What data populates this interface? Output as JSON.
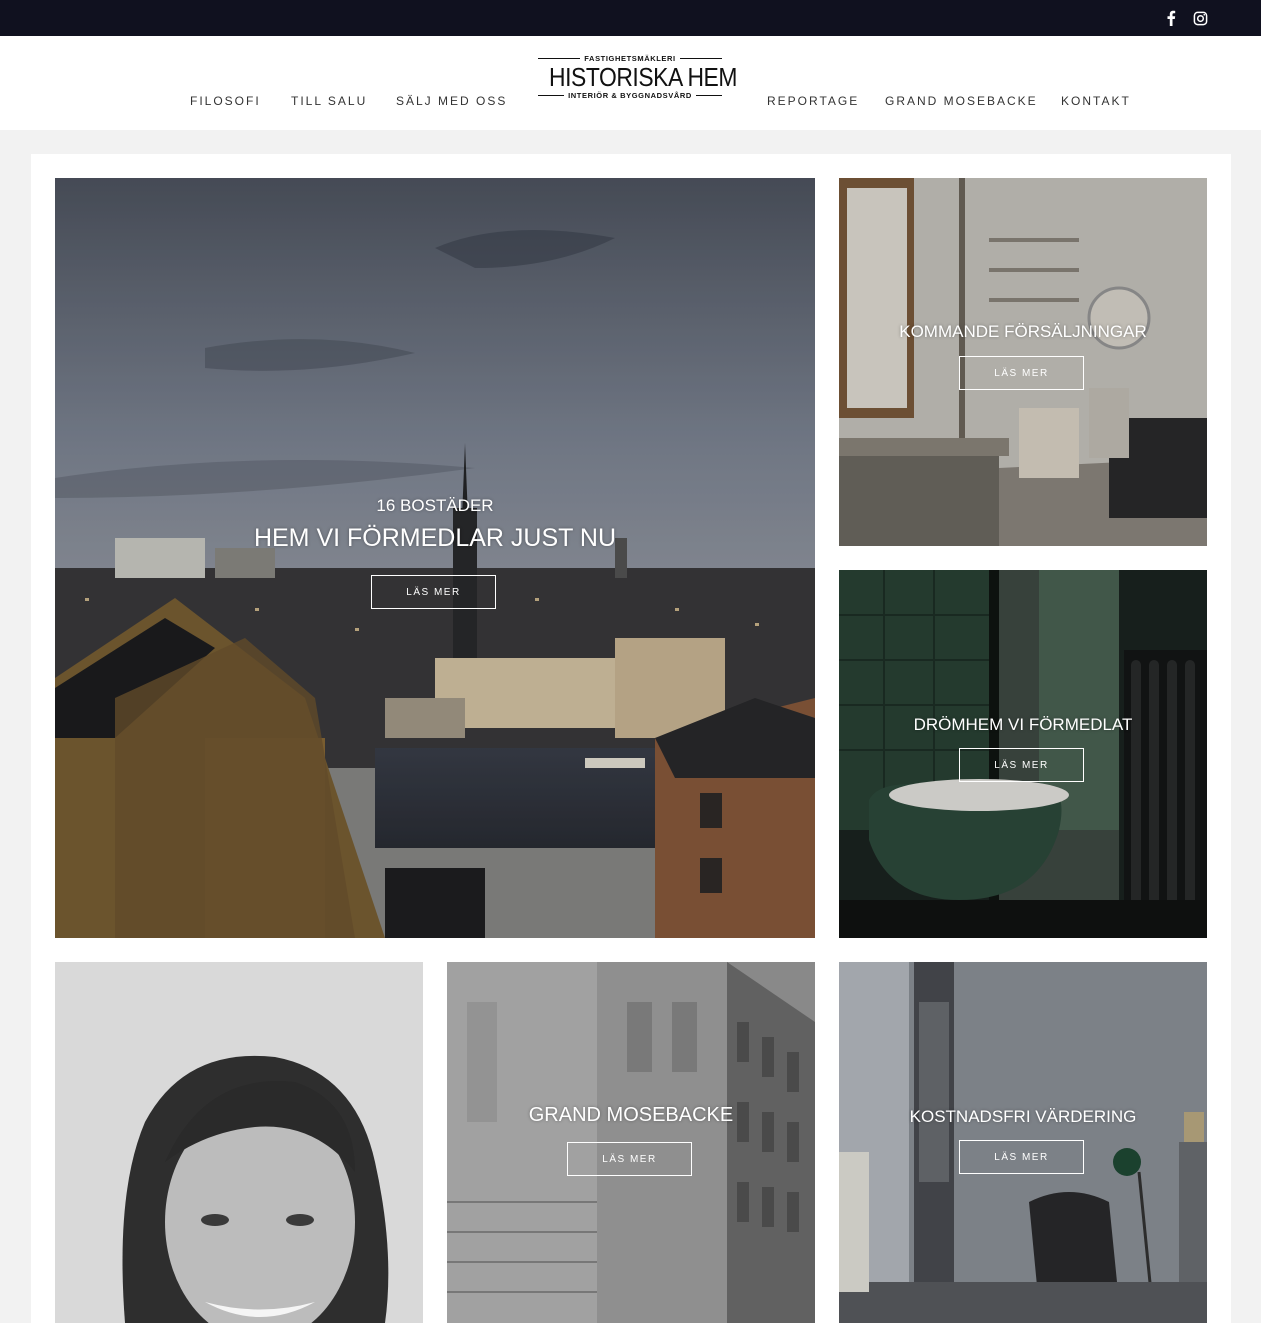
{
  "social": {
    "facebook_icon": "facebook-icon",
    "instagram_icon": "instagram-icon"
  },
  "logo": {
    "top_text": "FASTIGHETSMÄKLERI",
    "main_text": "HISTORISKA HEM",
    "bottom_text": "INTERIÖR & BYGGNADSVÅRD"
  },
  "nav": {
    "left": [
      "FILOSOFI",
      "TILL SALU",
      "SÄLJ MED OSS"
    ],
    "right": [
      "REPORTAGE",
      "GRAND MOSEBACKE",
      "KONTAKT"
    ]
  },
  "tiles": {
    "hero": {
      "subtitle": "16 BOSTÄDER",
      "title": "HEM VI FÖRMEDLAR JUST NU",
      "button": "LÄS MER"
    },
    "upcoming": {
      "title": "KOMMANDE FÖRSÄLJNINGAR",
      "button": "LÄS MER"
    },
    "dream": {
      "title": "DRÖMHEM VI FÖRMEDLAT",
      "button": "LÄS MER"
    },
    "mosebacke": {
      "title": "GRAND MOSEBACKE",
      "button": "LÄS MER"
    },
    "valuation": {
      "title": "KOSTNADSFRI VÄRDERING",
      "button": "LÄS MER"
    }
  },
  "colors": {
    "topbar": "#10111f",
    "panel": "#ffffff",
    "page_bg": "#f2f2f2",
    "text": "#333333"
  }
}
